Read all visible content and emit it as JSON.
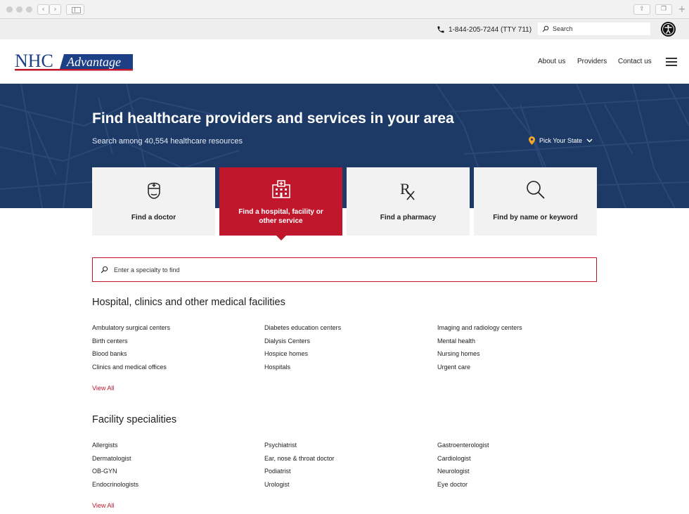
{
  "utility": {
    "phone": "1-844-205-7244 (TTY 711)",
    "search_placeholder": "Search"
  },
  "header": {
    "logo_primary": "NHC",
    "logo_secondary": "Advantage",
    "nav": [
      "About us",
      "Providers",
      "Contact us"
    ]
  },
  "hero": {
    "title": "Find healthcare providers and services in your area",
    "subtitle": "Search among 40,554 healthcare resources",
    "state_label": "Pick Your State"
  },
  "cards": [
    {
      "label": "Find a doctor",
      "icon": "doctor-icon",
      "active": false
    },
    {
      "label": "Find a hospital, facility or other service",
      "icon": "hospital-icon",
      "active": true
    },
    {
      "label": "Find a pharmacy",
      "icon": "rx-icon",
      "active": false
    },
    {
      "label": "Find by name or keyword",
      "icon": "search-icon",
      "active": false
    }
  ],
  "specialty_search": {
    "placeholder": "Enter a specialty to find"
  },
  "sections": [
    {
      "title": "Hospital, clinics and other medical facilities",
      "columns": [
        [
          "Ambulatory surgical centers",
          "Birth centers",
          "Blood banks",
          "Clinics and medical offices"
        ],
        [
          "Diabetes education centers",
          "Dialysis Centers",
          "Hospice homes",
          "Hospitals"
        ],
        [
          "Imaging and radiology centers",
          "Mental health",
          "Nursing homes",
          "Urgent care"
        ]
      ],
      "view_all": "View All"
    },
    {
      "title": "Facility specialities",
      "columns": [
        [
          "Allergists",
          "Dermatologist",
          "OB-GYN",
          "Endocrinologists"
        ],
        [
          "Psychiatrist",
          "Ear, nose & throat doctor",
          "Podiatrist",
          "Urologist"
        ],
        [
          "Gastroenterologist",
          "Cardiologist",
          "Neurologist",
          "Eye doctor"
        ]
      ],
      "view_all": "View All"
    }
  ],
  "colors": {
    "brand_red": "#c0172d",
    "hero_navy": "#1d3a66",
    "logo_blue": "#1d3f86",
    "pin_gold": "#f5a623"
  }
}
